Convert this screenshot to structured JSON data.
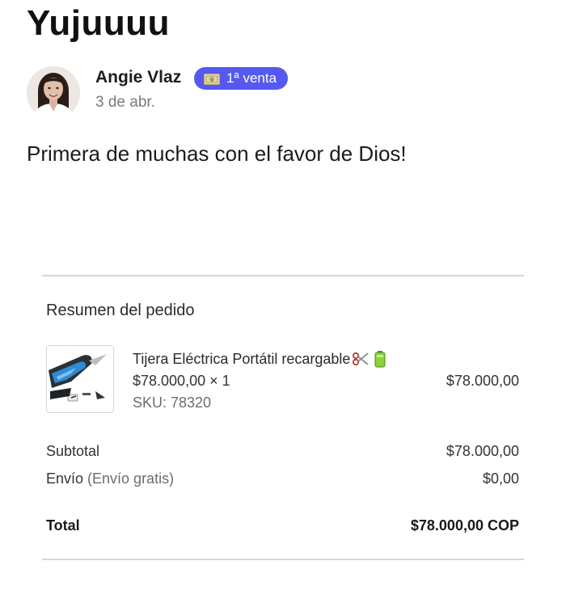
{
  "post": {
    "title": "Yujuuuu",
    "author_name": "Angie Vlaz",
    "badge": {
      "icon": "money-icon",
      "label": "1ª venta",
      "color": "#5559f0"
    },
    "date": "3 de abr.",
    "body": "Primera de muchas con el favor de Dios!"
  },
  "order_summary": {
    "heading": "Resumen del pedido",
    "item": {
      "name": "Tijera Eléctrica Portátil recargable",
      "name_icons": [
        "scissors-icon",
        "battery-icon"
      ],
      "unit_price_qty": "$78.000,00 × 1",
      "sku": "SKU: 78320",
      "line_total": "$78.000,00"
    },
    "subtotal": {
      "label": "Subtotal",
      "value": "$78.000,00"
    },
    "shipping": {
      "label": "Envío",
      "method": "(Envío gratis)",
      "value": "$0,00"
    },
    "total": {
      "label": "Total",
      "value": "$78.000,00 COP"
    }
  }
}
